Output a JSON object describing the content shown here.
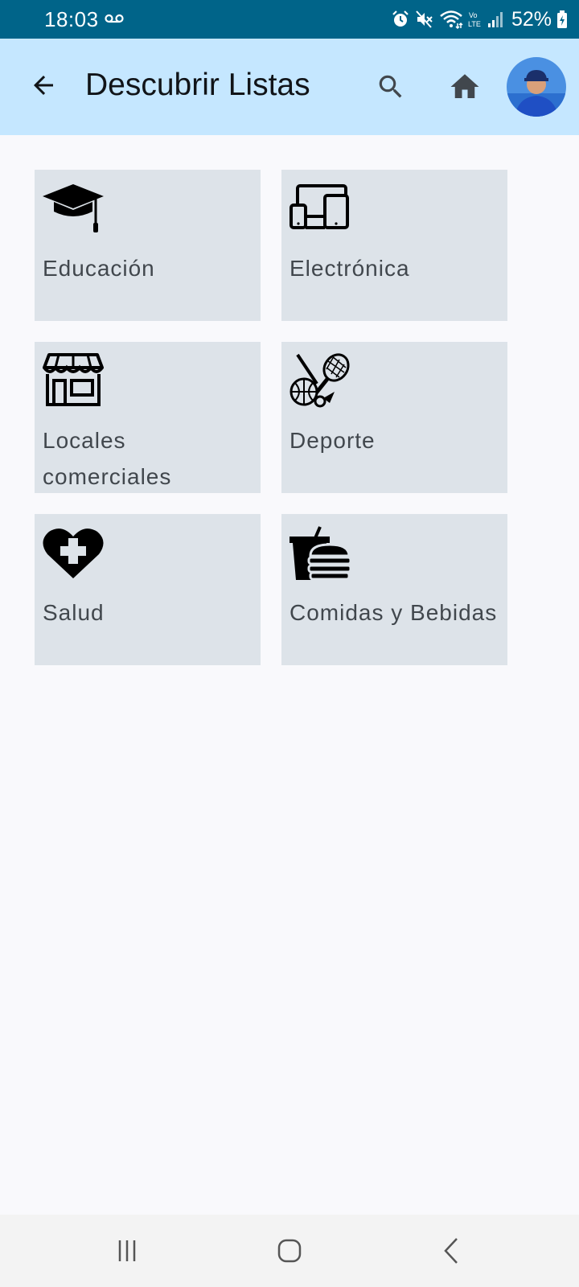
{
  "status_bar": {
    "time": "18:03",
    "battery": "52%",
    "bg_color": "#006489",
    "icons": [
      "voicemail-icon",
      "alarm-icon",
      "mute-icon",
      "wifi-icon",
      "volte-icon",
      "signal-icon",
      "battery-charging-icon"
    ]
  },
  "app_bar": {
    "title": "Descubrir Listas",
    "bg_color": "#c5e7ff",
    "icons": [
      "arrow-back-icon",
      "search-icon",
      "home-icon",
      "avatar"
    ]
  },
  "categories": [
    {
      "label": "Educación",
      "icon": "graduation-cap-icon"
    },
    {
      "label": "Electrónica",
      "icon": "devices-icon"
    },
    {
      "label": "Locales comerciales",
      "icon": "storefront-icon"
    },
    {
      "label": "Deporte",
      "icon": "sports-icon"
    },
    {
      "label": "Salud",
      "icon": "heart-plus-icon"
    },
    {
      "label": "Comidas y Bebidas",
      "icon": "fast-food-icon"
    }
  ],
  "tile_color": "#dde3e9",
  "nav_bar": {
    "icons": [
      "recent-apps-icon",
      "home-nav-icon",
      "back-nav-icon"
    ]
  }
}
